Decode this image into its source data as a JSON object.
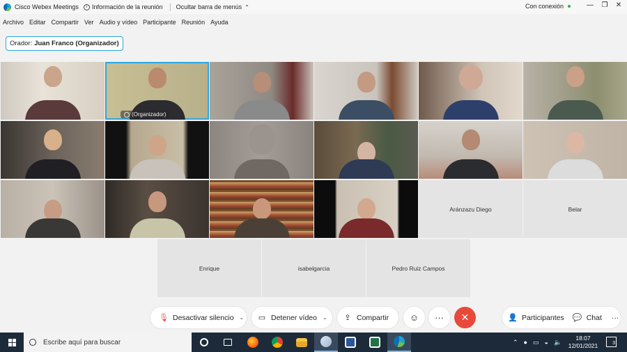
{
  "titlebar": {
    "app_name": "Cisco Webex Meetings",
    "meeting_info": "Información de la reunión",
    "hide_menu": "Ocultar barra de menús",
    "connection": "Con conexión",
    "minimize": "—",
    "restore": "❐",
    "close": "✕"
  },
  "menu": {
    "items": [
      "Archivo",
      "Editar",
      "Compartir",
      "Ver",
      "Audio y vídeo",
      "Participante",
      "Reunión",
      "Ayuda"
    ]
  },
  "speaker": {
    "prefix": "Orador:",
    "name": "Juan Franco (Organizador)"
  },
  "participants": {
    "organizer_label": "(Organizador)",
    "named_tiles": [
      "Aránzazu Diego",
      "Belar",
      "Enrique",
      "isabelgarcia",
      "Pedro Ruiz Campos"
    ]
  },
  "controls": {
    "mute": "Desactivar silencio",
    "video": "Detener vídeo",
    "share": "Compartir",
    "reactions_icon": "smile-icon",
    "more": "···",
    "end_icon": "close-icon",
    "participants": "Participantes",
    "chat": "Chat",
    "more_right": "···"
  },
  "taskbar": {
    "search_placeholder": "Escribe aquí para buscar",
    "time": "18:07",
    "date": "12/01/2021",
    "notifications": "3"
  },
  "colors": {
    "accent": "#2aa7e0",
    "end_call": "#e8493b",
    "taskbar": "#1d2a3a",
    "connected": "#35a853"
  }
}
